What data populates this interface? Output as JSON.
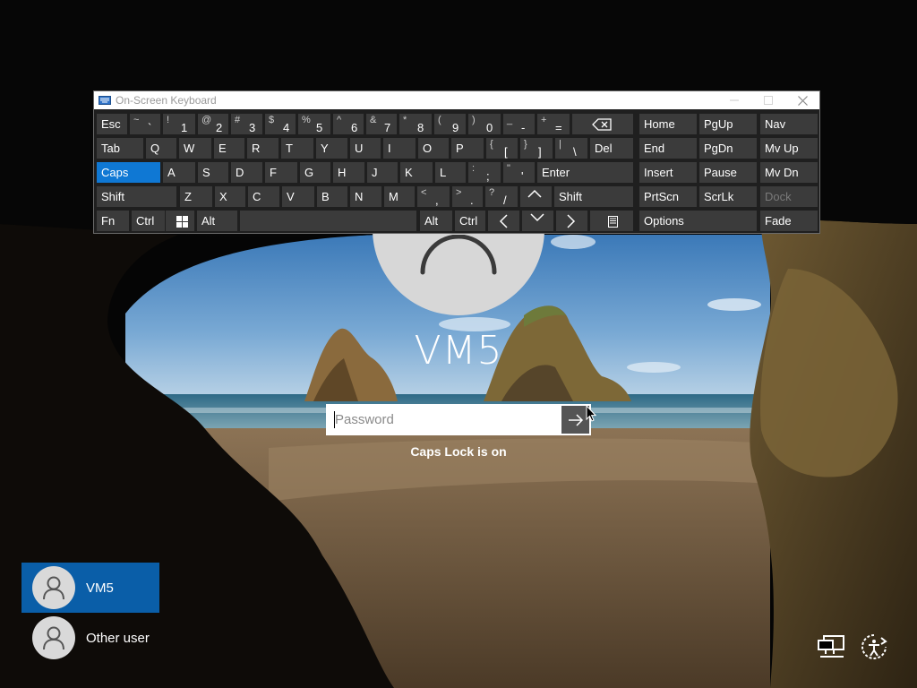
{
  "login": {
    "user_name": "VM5",
    "password_placeholder": "Password",
    "caps_lock_message": "Caps Lock is on"
  },
  "user_list": [
    {
      "label": "VM5",
      "selected": true
    },
    {
      "label": "Other user",
      "selected": false
    }
  ],
  "corner_icons": [
    "network-icon",
    "ease-of-access-icon"
  ],
  "osk": {
    "title": "On-Screen Keyboard",
    "window_buttons": [
      "minimize",
      "maximize",
      "close"
    ],
    "row1": [
      {
        "label": "Esc"
      },
      {
        "top": "~",
        "bot": "`"
      },
      {
        "top": "!",
        "bot": "1"
      },
      {
        "top": "@",
        "bot": "2"
      },
      {
        "top": "#",
        "bot": "3"
      },
      {
        "top": "$",
        "bot": "4"
      },
      {
        "top": "%",
        "bot": "5"
      },
      {
        "top": "^",
        "bot": "6"
      },
      {
        "top": "&",
        "bot": "7"
      },
      {
        "top": "*",
        "bot": "8"
      },
      {
        "top": "(",
        "bot": "9"
      },
      {
        "top": ")",
        "bot": "0"
      },
      {
        "top": "_",
        "bot": "-"
      },
      {
        "top": "+",
        "bot": "="
      },
      {
        "icon": "backspace-icon"
      }
    ],
    "row2": [
      {
        "label": "Tab"
      },
      {
        "label": "Q"
      },
      {
        "label": "W"
      },
      {
        "label": "E"
      },
      {
        "label": "R"
      },
      {
        "label": "T"
      },
      {
        "label": "Y"
      },
      {
        "label": "U"
      },
      {
        "label": "I"
      },
      {
        "label": "O"
      },
      {
        "label": "P"
      },
      {
        "top": "{",
        "bot": "["
      },
      {
        "top": "}",
        "bot": "]"
      },
      {
        "top": "|",
        "bot": "\\"
      },
      {
        "label": "Del"
      }
    ],
    "row3": [
      {
        "label": "Caps",
        "active": true
      },
      {
        "label": "A"
      },
      {
        "label": "S"
      },
      {
        "label": "D"
      },
      {
        "label": "F"
      },
      {
        "label": "G"
      },
      {
        "label": "H"
      },
      {
        "label": "J"
      },
      {
        "label": "K"
      },
      {
        "label": "L"
      },
      {
        "top": ":",
        "bot": ";"
      },
      {
        "top": "\"",
        "bot": "'"
      },
      {
        "label": "Enter"
      }
    ],
    "row4": [
      {
        "label": "Shift"
      },
      {
        "label": "Z"
      },
      {
        "label": "X"
      },
      {
        "label": "C"
      },
      {
        "label": "V"
      },
      {
        "label": "B"
      },
      {
        "label": "N"
      },
      {
        "label": "M"
      },
      {
        "top": "<",
        "bot": ","
      },
      {
        "top": ">",
        "bot": "."
      },
      {
        "top": "?",
        "bot": "/"
      },
      {
        "icon": "arrow-up-icon"
      },
      {
        "label": "Shift"
      }
    ],
    "row5": [
      {
        "label": "Fn"
      },
      {
        "label": "Ctrl"
      },
      {
        "icon": "windows-icon"
      },
      {
        "label": "Alt"
      },
      {
        "label": ""
      },
      {
        "label": "Alt"
      },
      {
        "label": "Ctrl"
      },
      {
        "icon": "arrow-left-icon"
      },
      {
        "icon": "arrow-down-icon"
      },
      {
        "icon": "arrow-right-icon"
      },
      {
        "icon": "menu-icon"
      }
    ],
    "nav_keys": [
      [
        "Home",
        "PgUp",
        "Nav"
      ],
      [
        "End",
        "PgDn",
        "Mv Up"
      ],
      [
        "Insert",
        "Pause",
        "Mv Dn"
      ],
      [
        "PrtScn",
        "ScrLk",
        "Dock"
      ],
      [
        "Options",
        "Fade"
      ]
    ],
    "disabled_keys": [
      "Dock"
    ]
  },
  "colors": {
    "selection_blue": "#0a5ea8",
    "caps_active": "#0f78d4",
    "key_bg": "#3b3b3b",
    "keyboard_bg": "#1f1f1f"
  }
}
